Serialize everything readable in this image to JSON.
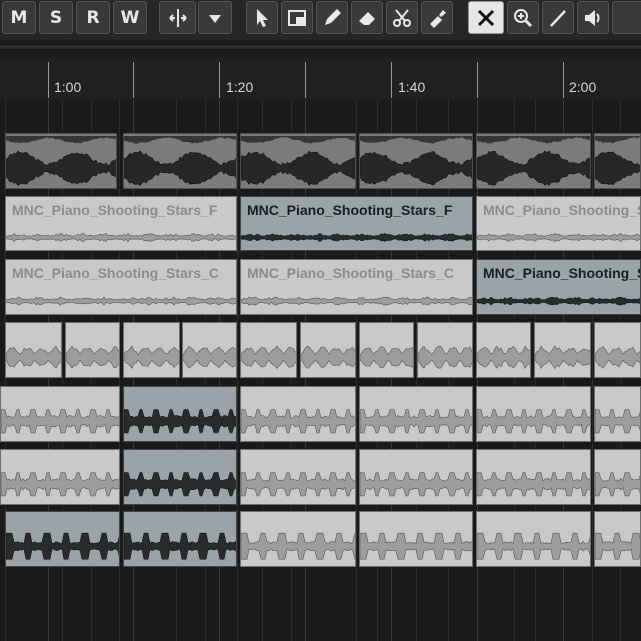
{
  "toolbar": {
    "m_label": "M",
    "s_label": "S",
    "r_label": "R",
    "w_label": "W",
    "icons": [
      "autoscroll-icon",
      "dropdown-icon",
      "pointer-icon",
      "range-icon",
      "pencil-icon",
      "eraser-icon",
      "scissors-icon",
      "glue-icon",
      "mute-tool-icon",
      "zoom-icon",
      "line-icon",
      "speaker-icon"
    ],
    "active_tool": "mute-tool-icon"
  },
  "ruler": {
    "labels": [
      "1:00",
      "1:20",
      "1:40",
      "2:00"
    ]
  },
  "tracks": [
    {
      "events": [
        {
          "name": "",
          "style": "dark"
        },
        {
          "name": "",
          "style": "dark"
        },
        {
          "name": "",
          "style": "dark"
        },
        {
          "name": "",
          "style": "dark"
        },
        {
          "name": "",
          "style": "dark"
        },
        {
          "name": "",
          "style": "dark"
        }
      ]
    },
    {
      "events": [
        {
          "name": "MNC_Piano_Shooting_Stars_F",
          "style": "light"
        },
        {
          "name": "MNC_Piano_Shooting_Stars_F",
          "style": "sel"
        },
        {
          "name": "MNC_Piano_Shooting_Stars_F",
          "style": "light"
        }
      ]
    },
    {
      "events": [
        {
          "name": "MNC_Piano_Shooting_Stars_C",
          "style": "light"
        },
        {
          "name": "MNC_Piano_Shooting_Stars_C",
          "style": "light"
        },
        {
          "name": "MNC_Piano_Shooting_Stars_C",
          "style": "sel"
        }
      ]
    },
    {
      "events": [
        {
          "name": "",
          "style": "light"
        },
        {
          "name": "",
          "style": "light"
        },
        {
          "name": "",
          "style": "light"
        },
        {
          "name": "",
          "style": "light"
        },
        {
          "name": "",
          "style": "light"
        },
        {
          "name": "",
          "style": "light"
        },
        {
          "name": "",
          "style": "light"
        },
        {
          "name": "",
          "style": "light"
        },
        {
          "name": "",
          "style": "light"
        },
        {
          "name": "",
          "style": "light"
        },
        {
          "name": "",
          "style": "light"
        },
        {
          "name": "",
          "style": "light"
        }
      ]
    },
    {
      "events": [
        {
          "name": "",
          "style": "light"
        },
        {
          "name": "",
          "style": "sel"
        },
        {
          "name": "",
          "style": "light"
        },
        {
          "name": "",
          "style": "light"
        },
        {
          "name": "",
          "style": "light"
        },
        {
          "name": "",
          "style": "light"
        }
      ]
    },
    {
      "events": [
        {
          "name": "",
          "style": "light"
        },
        {
          "name": "",
          "style": "sel"
        },
        {
          "name": "",
          "style": "light"
        },
        {
          "name": "",
          "style": "light"
        },
        {
          "name": "",
          "style": "light"
        },
        {
          "name": "",
          "style": "light"
        }
      ]
    },
    {
      "events": [
        {
          "name": "",
          "style": "sel"
        },
        {
          "name": "",
          "style": "sel"
        },
        {
          "name": "",
          "style": "light"
        },
        {
          "name": "",
          "style": "light"
        },
        {
          "name": "",
          "style": "light"
        },
        {
          "name": "",
          "style": "light"
        }
      ]
    }
  ]
}
